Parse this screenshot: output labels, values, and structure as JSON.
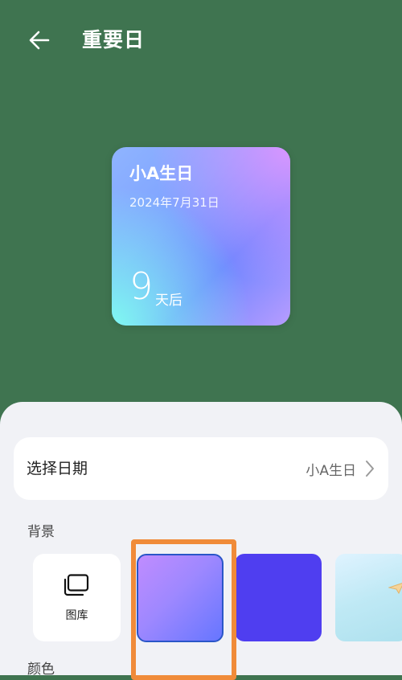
{
  "header": {
    "title": "重要日",
    "back_icon": "arrow-left-icon"
  },
  "widget": {
    "title": "小A生日",
    "date": "2024年7月31日",
    "days_count": "9",
    "days_unit": "天后"
  },
  "settings": {
    "date_row": {
      "label": "选择日期",
      "value": "小A生日",
      "chevron_icon": "chevron-right-icon"
    },
    "background": {
      "label": "背景",
      "gallery_label": "图库",
      "gallery_icon": "gallery-stack-icon",
      "swatches": [
        {
          "name": "purple-gradient",
          "selected": true
        },
        {
          "name": "indigo-solid",
          "selected": false
        },
        {
          "name": "sky-paper-plane",
          "selected": false
        }
      ]
    },
    "color": {
      "label": "颜色"
    }
  },
  "colors": {
    "page_background": "#3f7450",
    "sheet_background": "#f1f2f6",
    "highlight_orange": "#f08b39",
    "selected_border": "#2a56c8"
  }
}
